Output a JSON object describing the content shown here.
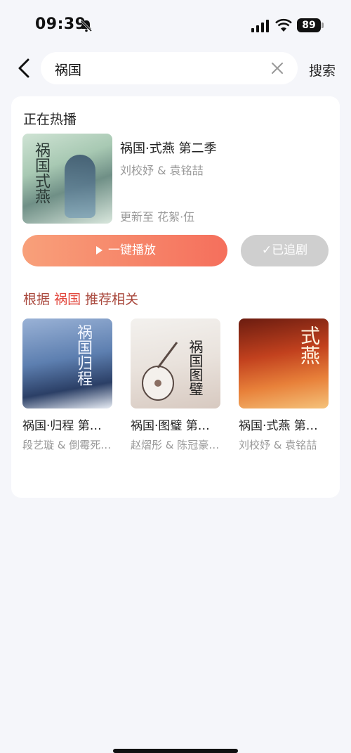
{
  "status": {
    "time": "09:39",
    "battery": "89"
  },
  "search": {
    "query": "祸国",
    "button": "搜索"
  },
  "now_playing": {
    "section_title": "正在热播",
    "cover_calligraphy": "祸国式燕",
    "title": "祸国·式燕 第二季",
    "cast": "刘校妤 & 袁铭喆",
    "update": "更新至  花絮·伍",
    "play_label": "一键播放",
    "follow_label": "✓已追剧"
  },
  "recommend": {
    "prefix": "根据",
    "keyword": "祸国",
    "suffix": "推荐相关",
    "items": [
      {
        "title": "祸国·归程 第…",
        "cast": "段艺璇 & 倒霉死…",
        "cover_calligraphy": "祸国归程"
      },
      {
        "title": "祸国·图璧 第…",
        "cast": "赵熠彤 & 陈冠豪…",
        "cover_calligraphy": "祸国图璧"
      },
      {
        "title": "祸国·式燕 第…",
        "cast": "刘校妤 & 袁铭喆",
        "cover_calligraphy": "式燕"
      }
    ]
  },
  "colors": {
    "accent": "#e2453b",
    "play_gradient_start": "#f8a07a",
    "play_gradient_end": "#f56f5c"
  }
}
